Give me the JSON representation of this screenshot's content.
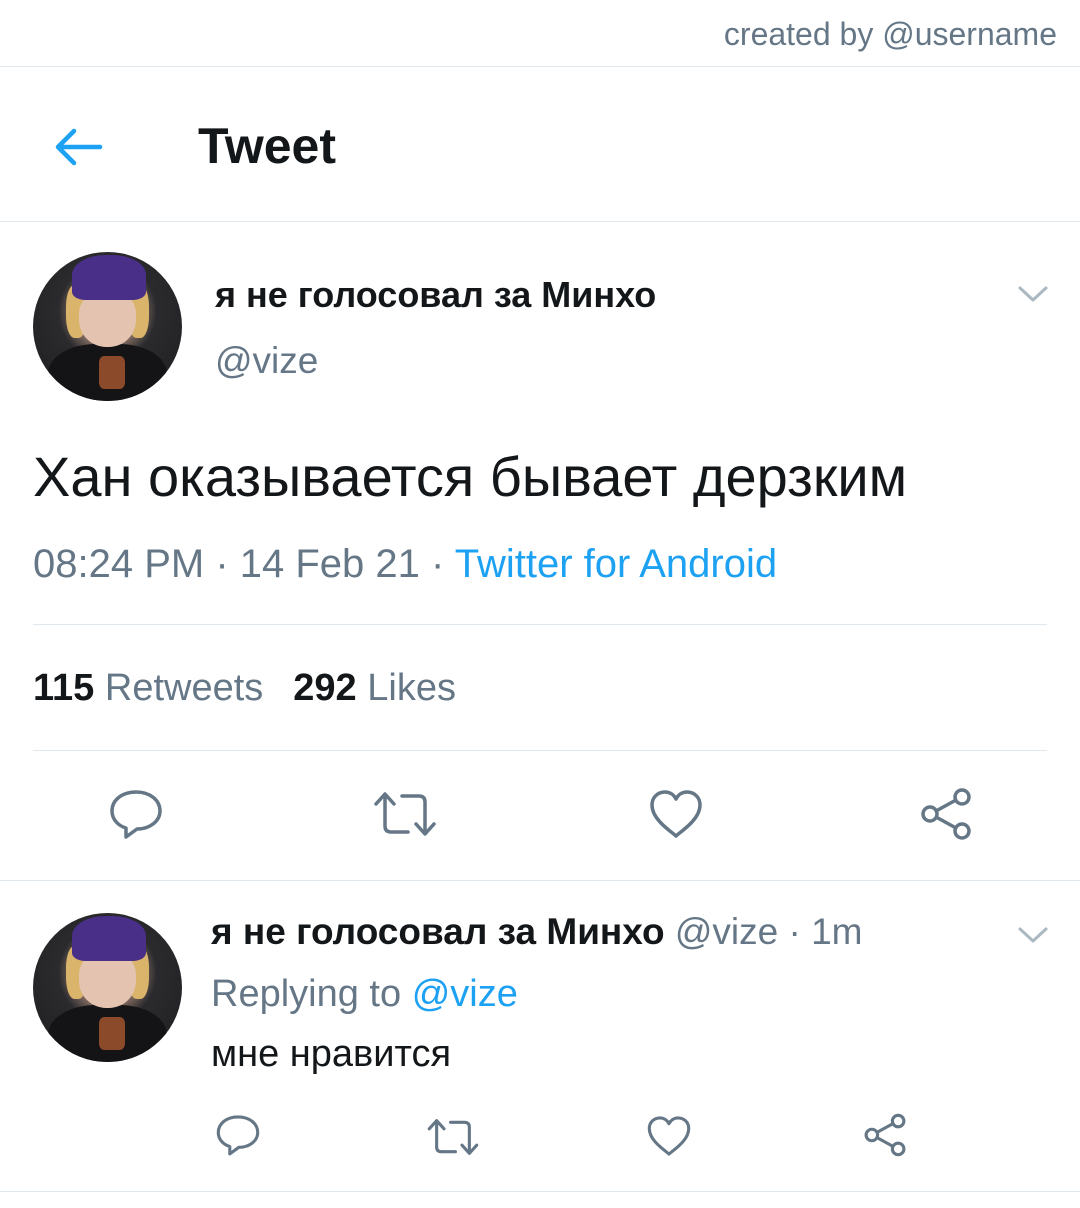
{
  "watermark": {
    "text": "created by @username"
  },
  "header": {
    "title": "Tweet",
    "back_icon": "arrow-left-icon"
  },
  "colors": {
    "accent": "#1da1f2",
    "muted": "#657786",
    "text": "#14171a",
    "border": "#e1e8ed"
  },
  "main_tweet": {
    "display_name": "я не голосовал за Минхо",
    "handle": "@vize",
    "text": "Хан оказывается бывает дерзким",
    "time": "08:24 PM",
    "date": "14 Feb 21",
    "separator": " · ",
    "source": "Twitter for Android",
    "retweets_count": "115",
    "retweets_label": "Retweets",
    "likes_count": "292",
    "likes_label": "Likes",
    "actions": [
      "reply-icon",
      "retweet-icon",
      "like-icon",
      "share-icon"
    ]
  },
  "reply_tweet": {
    "display_name": "я не голосовал за Минхо",
    "handle": "@vize",
    "time_ago": "1m",
    "separator": " · ",
    "replying_prefix": "Replying to",
    "replying_to": "@vize",
    "text": "мне нравится",
    "actions": [
      "reply-icon",
      "retweet-icon",
      "like-icon",
      "share-icon"
    ]
  }
}
